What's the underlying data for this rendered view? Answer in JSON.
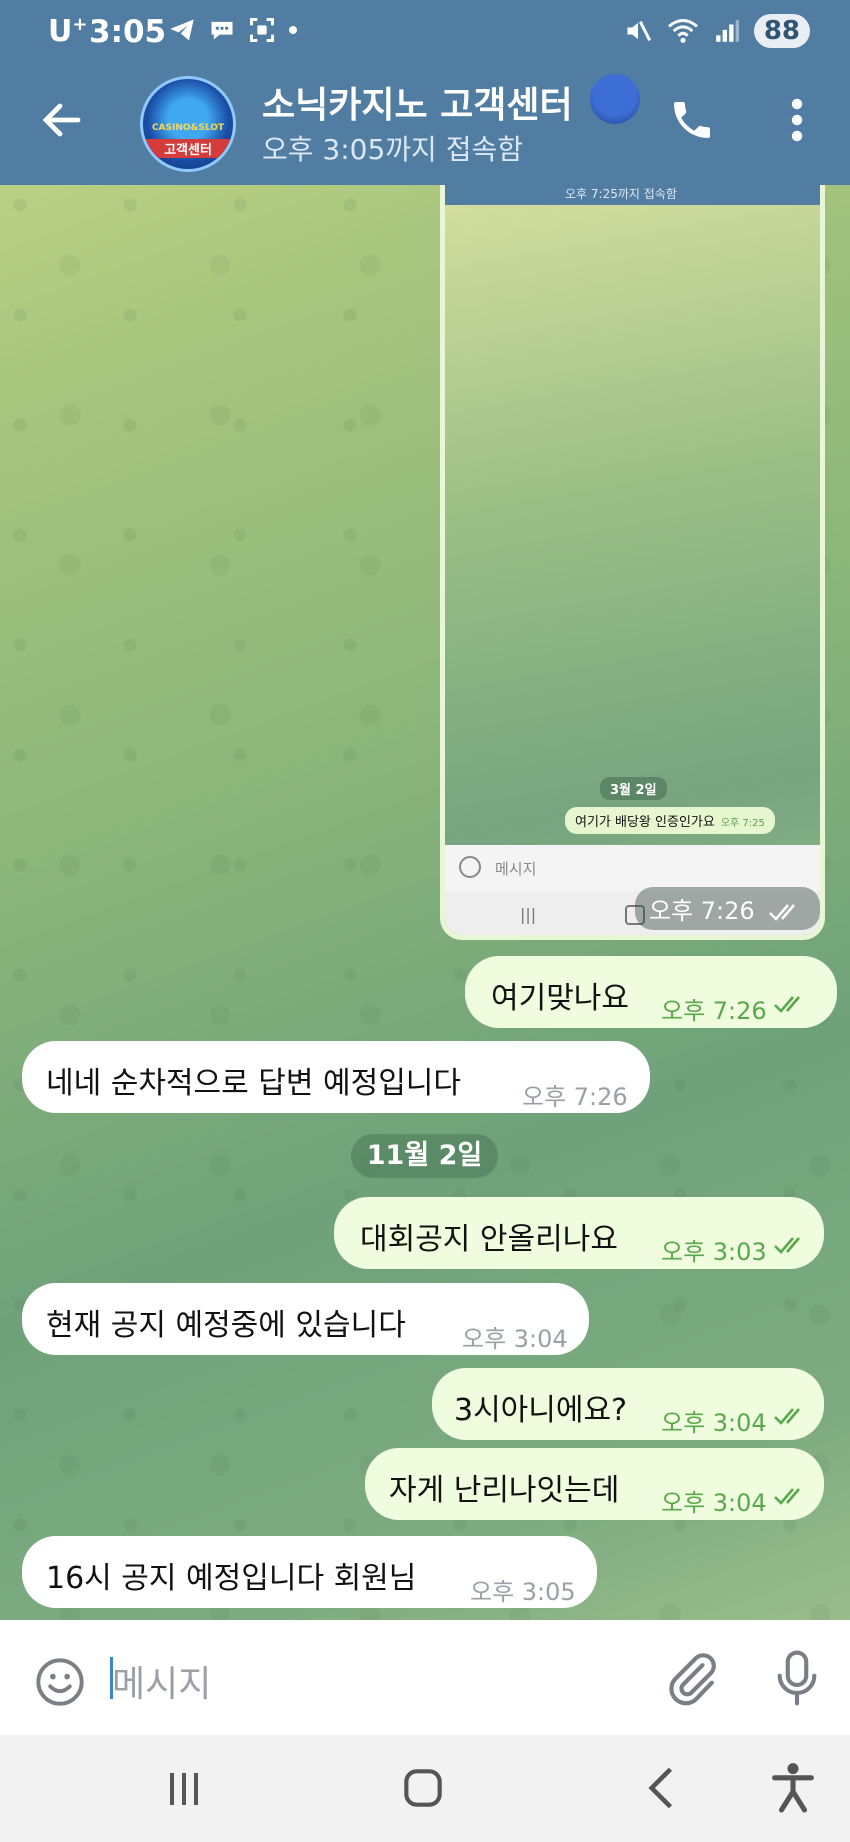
{
  "status_bar": {
    "carrier": "U",
    "carrier_sup": "+",
    "time": "3:05",
    "battery": "88"
  },
  "header": {
    "title": "소닉카지노 고객센터",
    "subtitle": "오후 3:05까지 접속함",
    "avatar_line1": "CASINO&SLOT",
    "avatar_line2": "고객센터"
  },
  "shared_image": {
    "header_text": "오후 7:25까지 접속함",
    "date": "3월 2일",
    "message": "여기가 배당왕 인증인가요",
    "message_time": "오후 7:25",
    "input_placeholder": "메시지",
    "time": "오후 7:26"
  },
  "messages": [
    {
      "text": "여기맞나요",
      "time": "오후 7:26",
      "direction": "out"
    },
    {
      "text": "네네 순차적으로 답변 예정입니다",
      "time": "오후 7:26",
      "direction": "in"
    },
    {
      "text": "대회공지 안올리나요",
      "time": "오후 3:03",
      "direction": "out"
    },
    {
      "text": "현재 공지 예정중에 있습니다",
      "time": "오후 3:04",
      "direction": "in"
    },
    {
      "text": "3시아니에요?",
      "time": "오후 3:04",
      "direction": "out"
    },
    {
      "text": "자게 난리나잇는데",
      "time": "오후 3:04",
      "direction": "out"
    },
    {
      "text": "16시 공지 예정입니다 회원님",
      "time": "오후 3:05",
      "direction": "in"
    }
  ],
  "date_chip": "11월 2일",
  "input": {
    "placeholder": "메시지"
  },
  "colors": {
    "header": "#527da3",
    "outgoing_bubble": "#effdde",
    "incoming_bubble": "#ffffff",
    "read_check": "#59a84c"
  }
}
